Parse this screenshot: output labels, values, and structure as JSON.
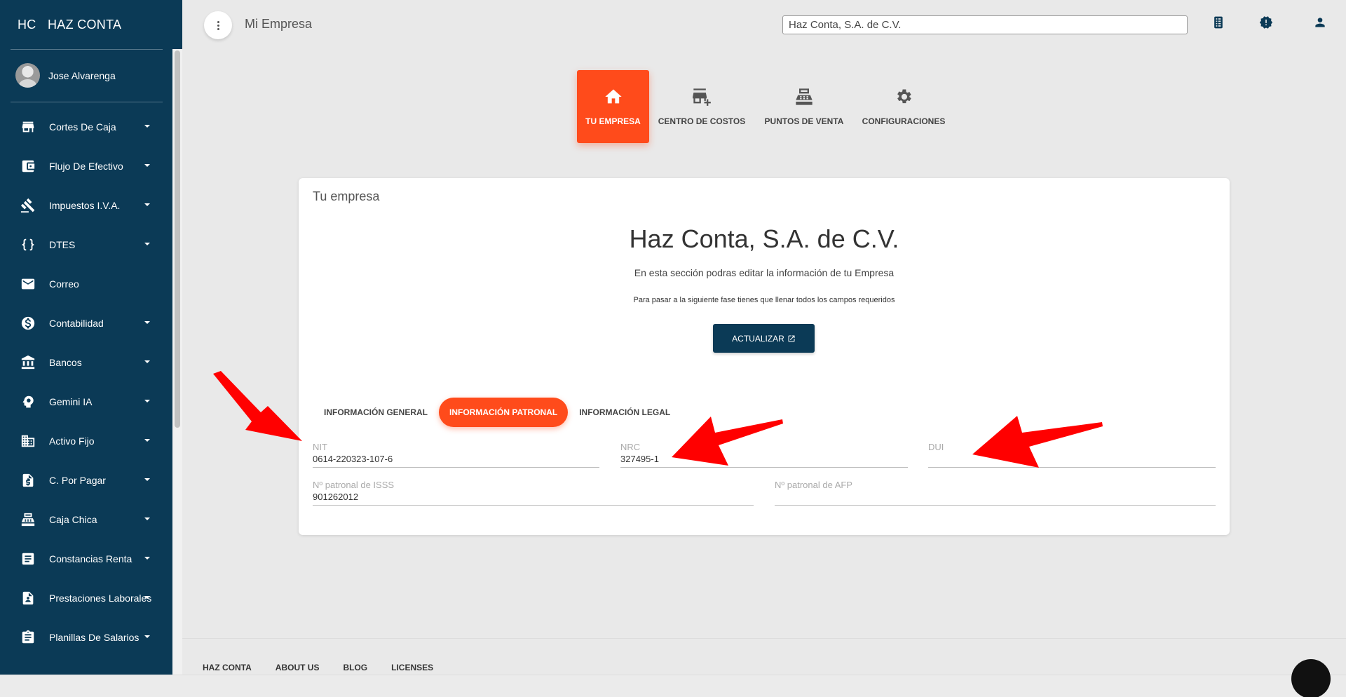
{
  "sidebar": {
    "brand_mini": "HC",
    "brand_name": "HAZ CONTA",
    "user_name": "Jose Alvarenga",
    "items": [
      {
        "label": "Cortes De Caja",
        "icon": "store-icon",
        "caret": true
      },
      {
        "label": "Flujo De Efectivo",
        "icon": "wallet-icon",
        "caret": true
      },
      {
        "label": "Impuestos I.V.A.",
        "icon": "gavel-icon",
        "caret": true
      },
      {
        "label": "DTES",
        "icon": "braces-icon",
        "caret": true
      },
      {
        "label": "Correo",
        "icon": "mail-icon",
        "caret": false
      },
      {
        "label": "Contabilidad",
        "icon": "dollar-circle-icon",
        "caret": true
      },
      {
        "label": "Bancos",
        "icon": "bank-icon",
        "caret": true
      },
      {
        "label": "Gemini IA",
        "icon": "psychology-icon",
        "caret": true
      },
      {
        "label": "Activo Fijo",
        "icon": "building-icon",
        "caret": true
      },
      {
        "label": "C. Por Pagar",
        "icon": "invoice-dollar-icon",
        "caret": true
      },
      {
        "label": "Caja Chica",
        "icon": "cash-register-icon",
        "caret": true
      },
      {
        "label": "Constancias Renta",
        "icon": "document-icon",
        "caret": true
      },
      {
        "label": "Prestaciones Laborales",
        "icon": "contact-doc-icon",
        "caret": true
      },
      {
        "label": "Planillas De Salarios",
        "icon": "clipboard-icon",
        "caret": true
      }
    ]
  },
  "header": {
    "title": "Mi Empresa",
    "company_select": "Haz Conta, S.A. de C.V.",
    "icons": [
      "building-list-icon",
      "alert-badge-icon",
      "person-icon"
    ]
  },
  "steps": [
    {
      "label": "TU EMPRESA",
      "icon": "home-icon",
      "active": true
    },
    {
      "label": "CENTRO DE COSTOS",
      "icon": "add-business-icon",
      "active": false
    },
    {
      "label": "PUNTOS DE VENTA",
      "icon": "cash-register-icon",
      "active": false
    },
    {
      "label": "CONFIGURACIONES",
      "icon": "gear-icon",
      "active": false
    }
  ],
  "card": {
    "title": "Tu empresa",
    "company_name": "Haz Conta, S.A. de C.V.",
    "description": "En esta sección podras editar la información de tu Empresa",
    "hint": "Para pasar a la siguiente fase tienes que llenar todos los campos requeridos",
    "update_button": "ACTUALIZAR",
    "tabs": [
      {
        "label": "INFORMACIÓN GENERAL",
        "active": false
      },
      {
        "label": "INFORMACIÓN PATRONAL",
        "active": true
      },
      {
        "label": "INFORMACIÓN LEGAL",
        "active": false
      }
    ],
    "fields": {
      "nit": {
        "label": "NIT",
        "value": "0614-220323-107-6"
      },
      "nrc": {
        "label": "NRC",
        "value": "327495-1"
      },
      "dui": {
        "label": "DUI",
        "value": ""
      },
      "isss": {
        "label": "Nº patronal de ISSS",
        "value": "901262012"
      },
      "afp": {
        "label": "Nº patronal de AFP",
        "value": ""
      }
    }
  },
  "footer": {
    "links": [
      "HAZ CONTA",
      "ABOUT US",
      "BLOG",
      "LICENSES"
    ]
  },
  "colors": {
    "sidebar": "#0b3a56",
    "accent": "#ff4b1b",
    "arrow": "#ff0000"
  }
}
